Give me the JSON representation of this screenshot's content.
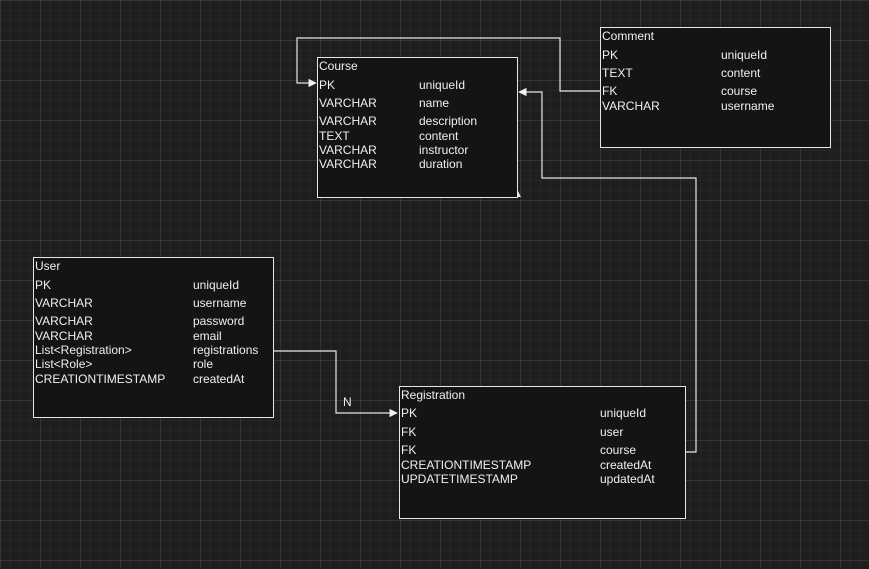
{
  "entities": {
    "course": {
      "title": "Course",
      "rows": [
        {
          "type": "PK",
          "field": "uniqueId"
        },
        {
          "type": "VARCHAR",
          "field": "name"
        },
        {
          "type": "VARCHAR",
          "field": "description"
        },
        {
          "type": "TEXT",
          "field": "content"
        },
        {
          "type": "VARCHAR",
          "field": "instructor"
        },
        {
          "type": "VARCHAR",
          "field": "duration"
        }
      ]
    },
    "comment": {
      "title": "Comment",
      "rows": [
        {
          "type": "PK",
          "field": "uniqueId"
        },
        {
          "type": "TEXT",
          "field": "content"
        },
        {
          "type": "FK",
          "field": "course"
        },
        {
          "type": "VARCHAR",
          "field": "username"
        }
      ]
    },
    "user": {
      "title": "User",
      "rows": [
        {
          "type": "PK",
          "field": "uniqueId"
        },
        {
          "type": "VARCHAR",
          "field": "username"
        },
        {
          "type": "VARCHAR",
          "field": "password"
        },
        {
          "type": "VARCHAR",
          "field": "email"
        },
        {
          "type": "List<Registration>",
          "field": "registrations"
        },
        {
          "type": "List<Role>",
          "field": "role"
        },
        {
          "type": "CREATIONTIMESTAMP",
          "field": "createdAt"
        }
      ]
    },
    "registration": {
      "title": "Registration",
      "rows": [
        {
          "type": "PK",
          "field": "uniqueId"
        },
        {
          "type": "FK",
          "field": "user"
        },
        {
          "type": "FK",
          "field": "course"
        },
        {
          "type": "CREATIONTIMESTAMP",
          "field": "createdAt"
        },
        {
          "type": "UPDATETIMESTAMP",
          "field": "updatedAt"
        }
      ]
    }
  },
  "edges": {
    "user_registration_label": "N"
  },
  "colors": {
    "background": "#1e1e1e",
    "entity_fill": "#141414",
    "stroke": "#e6e6e6",
    "text": "#f0f0f0"
  }
}
